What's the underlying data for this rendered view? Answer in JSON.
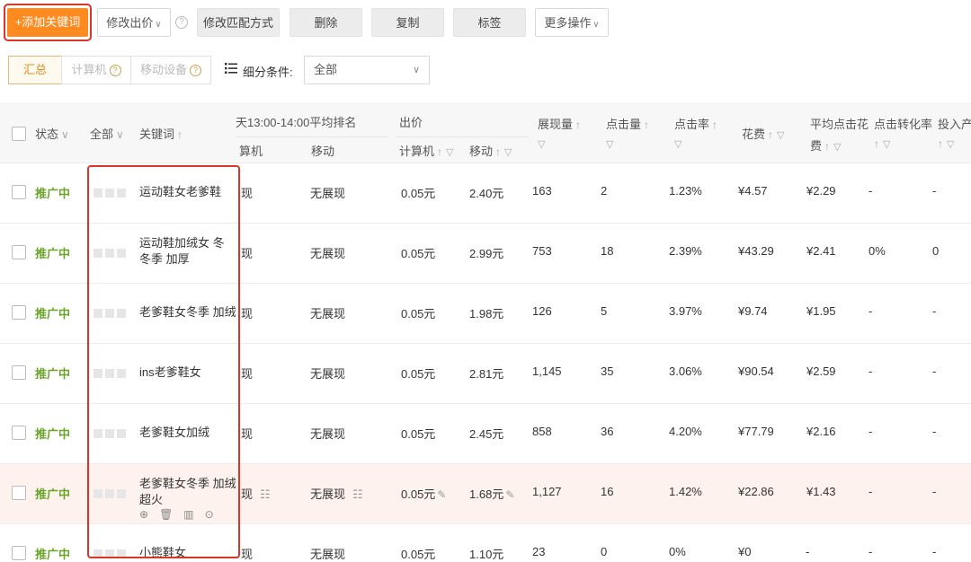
{
  "toolbar": {
    "add_keyword": "+添加关键词",
    "modify_bid": "修改出价",
    "modify_match": "修改匹配方式",
    "delete": "删除",
    "copy": "复制",
    "tag": "标签",
    "more_actions": "更多操作"
  },
  "filter": {
    "segments": [
      "汇总",
      "计算机",
      "移动设备"
    ],
    "label": "细分条件:",
    "select_value": "全部"
  },
  "table": {
    "headers": {
      "status": "状态",
      "all": "全部",
      "keyword": "关键词",
      "rank": "天13:00-14:00平均排名",
      "rank_pc": "算机",
      "rank_mobile": "移动",
      "bid": "出价",
      "bid_pc": "计算机",
      "bid_mobile": "移动",
      "impressions": "展现量",
      "clicks": "点击量",
      "ctr": "点击率",
      "cost": "花费",
      "avg_cpc_1": "平均点击花",
      "avg_cpc_2": "费",
      "cvr": "点击转化率",
      "roi": "投入产"
    },
    "rows": [
      {
        "status": "推广中",
        "keyword": "运动鞋女老爹鞋",
        "rank_pc": "现",
        "rank_mobile": "无展现",
        "bid_pc": "0.05元",
        "bid_mobile": "2.40元",
        "impressions": "163",
        "clicks": "2",
        "ctr": "1.23%",
        "cost": "¥4.57",
        "avg_cpc": "¥2.29",
        "cvr": "-",
        "roi": "-"
      },
      {
        "status": "推广中",
        "keyword": "运动鞋加绒女 冬 冬季 加厚",
        "rank_pc": "现",
        "rank_mobile": "无展现",
        "bid_pc": "0.05元",
        "bid_mobile": "2.99元",
        "impressions": "753",
        "clicks": "18",
        "ctr": "2.39%",
        "cost": "¥43.29",
        "avg_cpc": "¥2.41",
        "cvr": "0%",
        "roi": "0"
      },
      {
        "status": "推广中",
        "keyword": "老爹鞋女冬季 加绒",
        "rank_pc": "现",
        "rank_mobile": "无展现",
        "bid_pc": "0.05元",
        "bid_mobile": "1.98元",
        "impressions": "126",
        "clicks": "5",
        "ctr": "3.97%",
        "cost": "¥9.74",
        "avg_cpc": "¥1.95",
        "cvr": "-",
        "roi": "-"
      },
      {
        "status": "推广中",
        "keyword": "ins老爹鞋女",
        "rank_pc": "现",
        "rank_mobile": "无展现",
        "bid_pc": "0.05元",
        "bid_mobile": "2.81元",
        "impressions": "1,145",
        "clicks": "35",
        "ctr": "3.06%",
        "cost": "¥90.54",
        "avg_cpc": "¥2.59",
        "cvr": "-",
        "roi": "-"
      },
      {
        "status": "推广中",
        "keyword": "老爹鞋女加绒",
        "rank_pc": "现",
        "rank_mobile": "无展现",
        "bid_pc": "0.05元",
        "bid_mobile": "2.45元",
        "impressions": "858",
        "clicks": "36",
        "ctr": "4.20%",
        "cost": "¥77.79",
        "avg_cpc": "¥2.16",
        "cvr": "-",
        "roi": "-"
      },
      {
        "status": "推广中",
        "keyword": "老爹鞋女冬季 加绒超火",
        "rank_pc": "现",
        "rank_mobile": "无展现",
        "bid_pc": "0.05元",
        "bid_mobile": "1.68元",
        "impressions": "1,127",
        "clicks": "16",
        "ctr": "1.42%",
        "cost": "¥22.86",
        "avg_cpc": "¥1.43",
        "cvr": "-",
        "roi": "-"
      },
      {
        "status": "推广中",
        "keyword": "小熊鞋女",
        "rank_pc": "现",
        "rank_mobile": "无展现",
        "bid_pc": "0.05元",
        "bid_mobile": "1.10元",
        "impressions": "23",
        "clicks": "0",
        "ctr": "0%",
        "cost": "¥0",
        "avg_cpc": "-",
        "cvr": "-",
        "roi": "-"
      }
    ]
  },
  "colors": {
    "accent": "#ff8a1f",
    "status_green": "#6aa52a",
    "highlight_frame": "#d9352b"
  }
}
